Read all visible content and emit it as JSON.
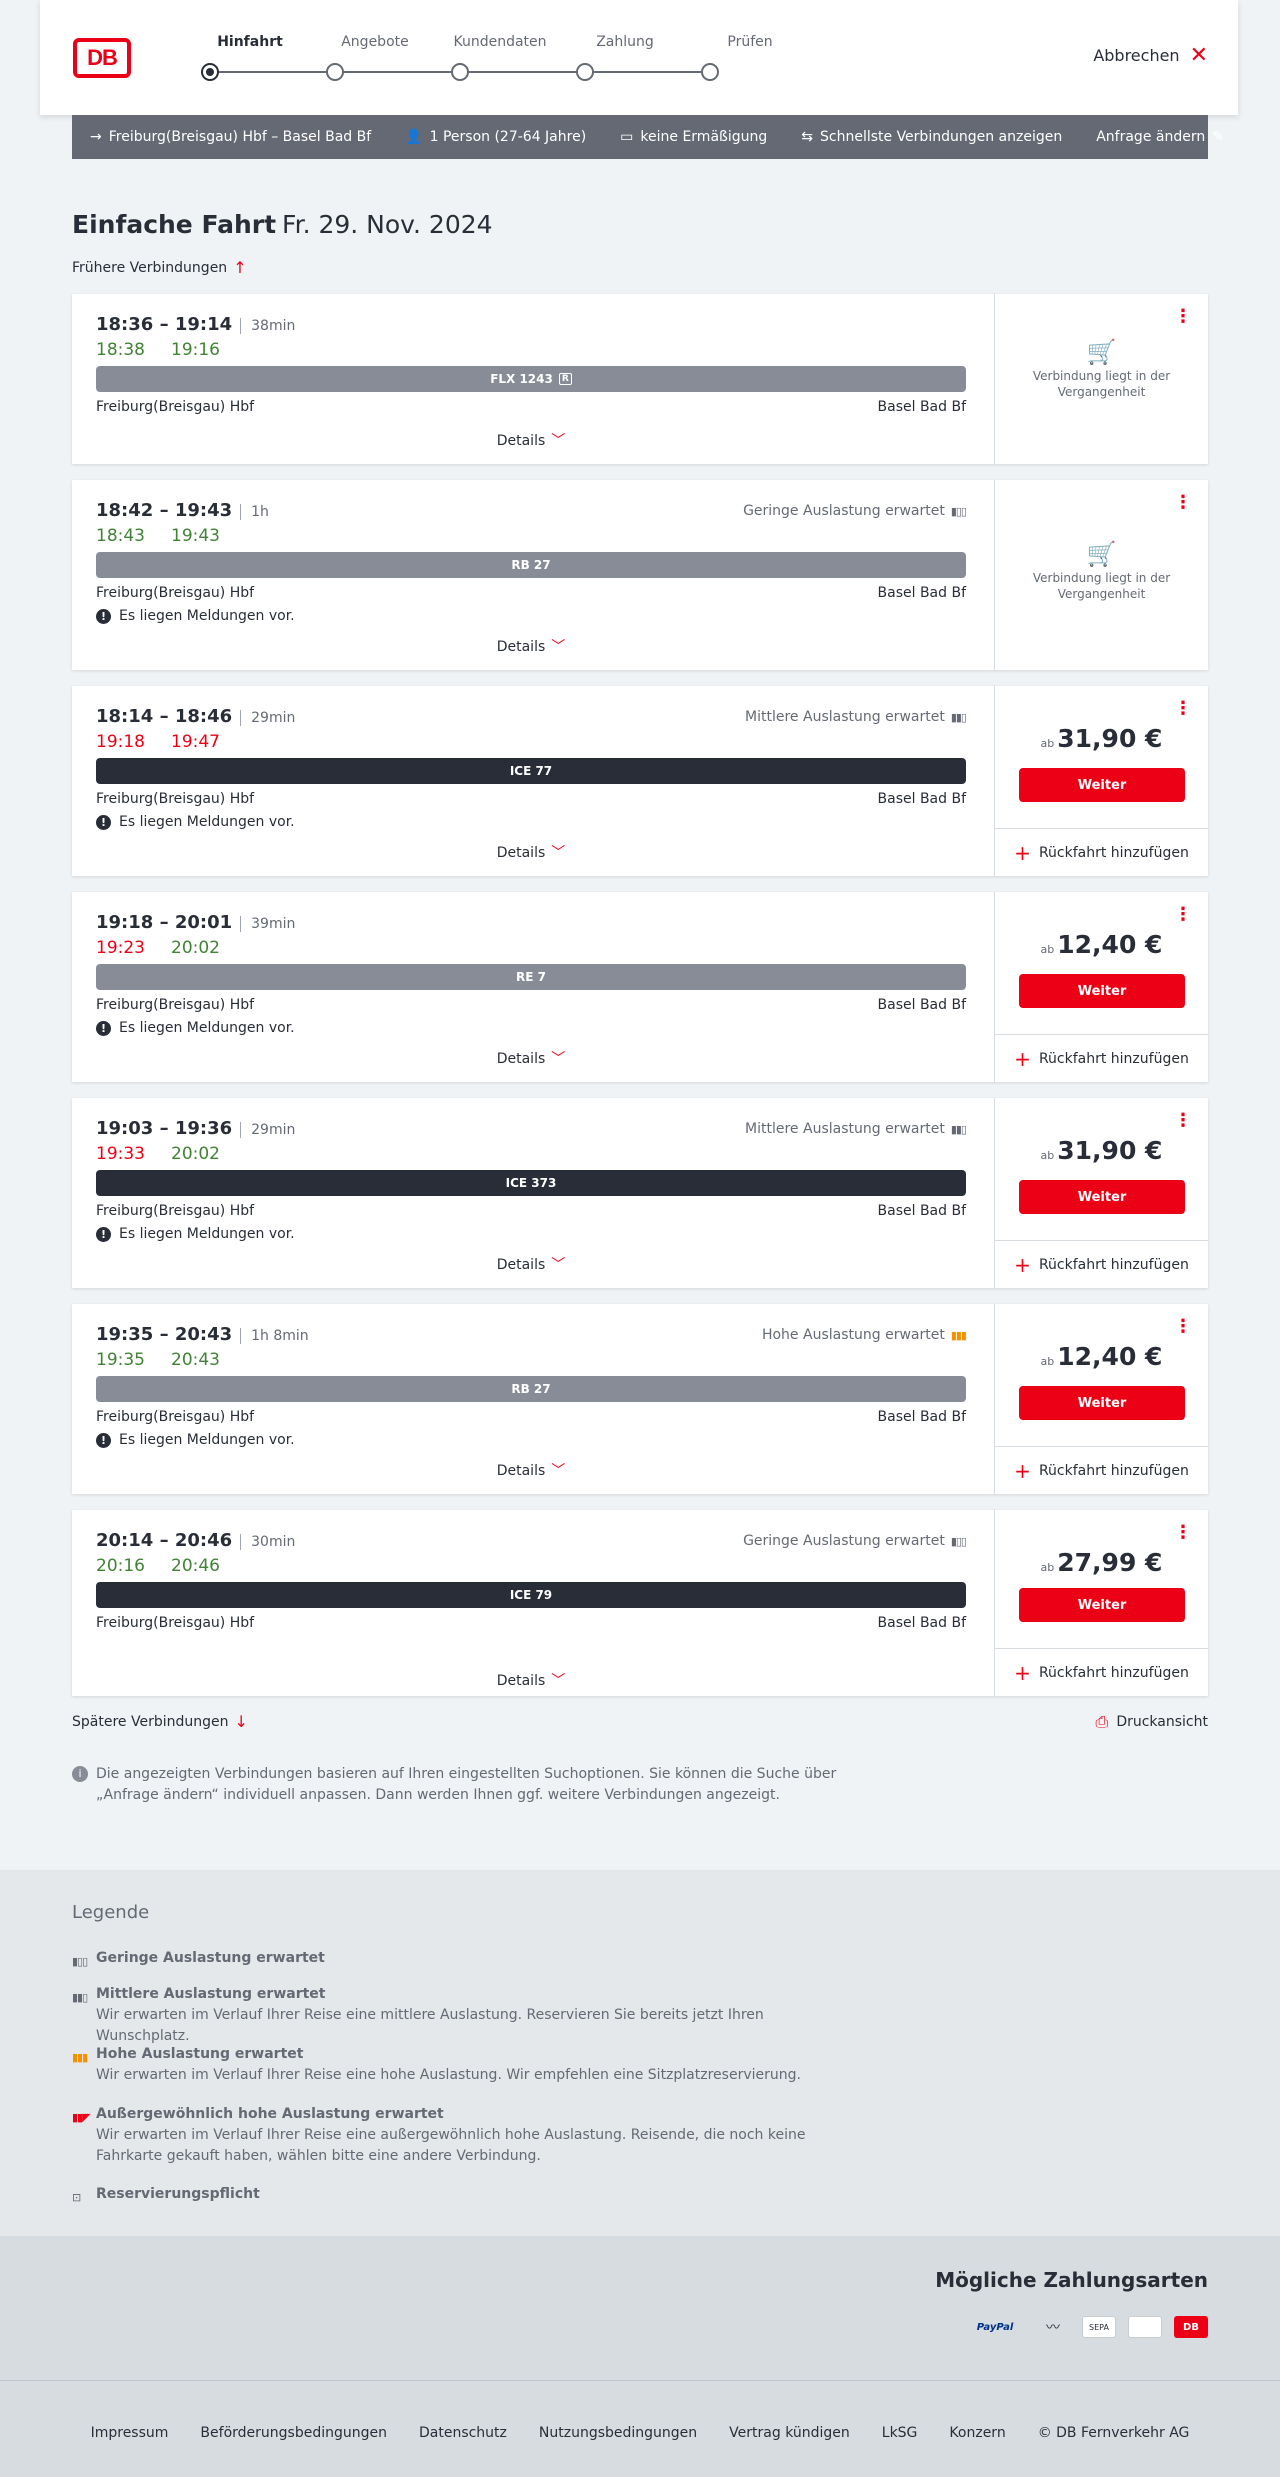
{
  "header": {
    "logo": "DB",
    "steps": [
      "Hinfahrt",
      "Angebote",
      "Kundendaten",
      "Zahlung",
      "Prüfen"
    ],
    "cancel_label": "Abbrechen"
  },
  "searchbar": {
    "route": "Freiburg(Breisgau) Hbf – Basel Bad Bf",
    "persons": "1 Person (27-64 Jahre)",
    "discount": "keine Ermäßigung",
    "filter": "Schnellste Verbindungen anzeigen",
    "change": "Anfrage ändern"
  },
  "page": {
    "title_bold": "Einfache Fahrt",
    "title_date": "Fr. 29. Nov. 2024",
    "earlier": "Frühere Verbindungen",
    "later": "Spätere Verbindungen",
    "print": "Druckansicht",
    "info": "Die angezeigten Verbindungen basieren auf Ihren eingestellten Suchoptionen. Sie können die Suche über „Anfrage ändern“ individuell anpassen. Dann werden Ihnen ggf. weitere Verbindungen angezeigt."
  },
  "labels": {
    "details": "Details",
    "messages": "Es liegen Meldungen vor.",
    "past": "Verbindung liegt in der Vergangenheit",
    "from": "ab",
    "continue": "Weiter",
    "return": "Rückfahrt hinzufügen",
    "origin": "Freiburg(Breisgau) Hbf",
    "destination": "Basel Bad Bf"
  },
  "connections": [
    {
      "time": "18:36 – 19:14",
      "duration": "38min",
      "rt_dep": "18:38",
      "rt_arr": "19:16",
      "train": "FLX 1243",
      "occupancy": "",
      "price": ""
    },
    {
      "time": "18:42 – 19:43",
      "duration": "1h",
      "rt_dep": "18:43",
      "rt_arr": "19:43",
      "train": "RB 27",
      "occupancy": "Geringe Auslastung erwartet",
      "price": ""
    },
    {
      "time": "18:14 – 18:46",
      "duration": "29min",
      "rt_dep": "19:18",
      "rt_arr": "19:47",
      "train": "ICE 77",
      "occupancy": "Mittlere Auslastung erwartet",
      "price": "31,90 €"
    },
    {
      "time": "19:18 – 20:01",
      "duration": "39min",
      "rt_dep": "19:23",
      "rt_arr": "20:02",
      "train": "RE 7",
      "occupancy": "",
      "price": "12,40 €"
    },
    {
      "time": "19:03 – 19:36",
      "duration": "29min",
      "rt_dep": "19:33",
      "rt_arr": "20:02",
      "train": "ICE 373",
      "occupancy": "Mittlere Auslastung erwartet",
      "price": "31,90 €"
    },
    {
      "time": "19:35 – 20:43",
      "duration": "1h 8min",
      "rt_dep": "19:35",
      "rt_arr": "20:43",
      "train": "RB 27",
      "occupancy": "Hohe Auslastung erwartet",
      "price": "12,40 €"
    },
    {
      "time": "20:14 – 20:46",
      "duration": "30min",
      "rt_dep": "20:16",
      "rt_arr": "20:46",
      "train": "ICE 79",
      "occupancy": "Geringe Auslastung erwartet",
      "price": "27,99 €"
    }
  ],
  "legend": {
    "title": "Legende",
    "items": [
      {
        "title": "Geringe Auslastung erwartet",
        "text": ""
      },
      {
        "title": "Mittlere Auslastung erwartet",
        "text": "Wir erwarten im Verlauf Ihrer Reise eine mittlere Auslastung. Reservieren Sie bereits jetzt Ihren Wunschplatz."
      },
      {
        "title": "Hohe Auslastung erwartet",
        "text": "Wir erwarten im Verlauf Ihrer Reise eine hohe Auslastung. Wir empfehlen eine Sitzplatzreservierung."
      },
      {
        "title": "Außergewöhnlich hohe Auslastung erwartet",
        "text": "Wir erwarten im Verlauf Ihrer Reise eine außergewöhnlich hohe Auslastung. Reisende, die noch keine Fahrkarte gekauft haben, wählen bitte eine andere Verbindung."
      },
      {
        "title": "Reservierungspflicht",
        "text": ""
      }
    ]
  },
  "payment": {
    "title": "Mögliche Zahlungsarten",
    "methods": [
      "PayPal",
      "Kreditkarte",
      "SEPA",
      "Apple Pay",
      "DB"
    ]
  },
  "footer": {
    "links": [
      "Impressum",
      "Beförderungsbedingungen",
      "Datenschutz",
      "Nutzungsbedingungen",
      "Vertrag kündigen",
      "LkSG",
      "Konzern",
      "© DB Fernverkehr AG"
    ]
  },
  "colors": {
    "brand": "#ec0016",
    "ontime": "#408335",
    "delay": "#ec0016",
    "dark": "#282d37"
  }
}
